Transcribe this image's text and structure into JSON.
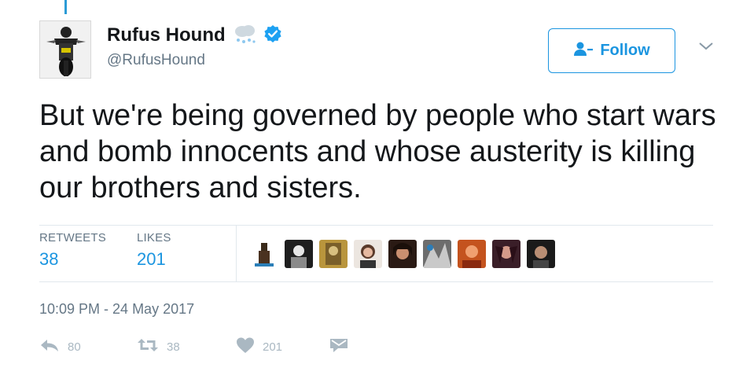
{
  "author": {
    "display_name": "Rufus Hound",
    "handle": "@RufusHound"
  },
  "follow_button": {
    "label": "Follow"
  },
  "tweet": {
    "text": "But we're being governed by people who start wars and bomb innocents and whose austerity is killing our brothers and sisters."
  },
  "stats": {
    "retweets_label": "RETWEETS",
    "retweets_count": "38",
    "likes_label": "LIKES",
    "likes_count": "201"
  },
  "liker_avatars": 9,
  "timestamp": "10:09 PM - 24 May 2017",
  "actions": {
    "reply_count": "80",
    "retweet_count": "38",
    "like_count": "201"
  },
  "colors": {
    "accent": "#1b95e0",
    "text": "#14171a",
    "muted": "#657786",
    "action_gray": "#aab8c2",
    "verified": "#1da1f2"
  },
  "icons": [
    "user-avatar",
    "weather-snow-icon",
    "verified-badge-icon",
    "follow-person-icon",
    "chevron-down-icon",
    "reply-icon",
    "retweet-icon",
    "heart-icon",
    "direct-message-icon"
  ]
}
